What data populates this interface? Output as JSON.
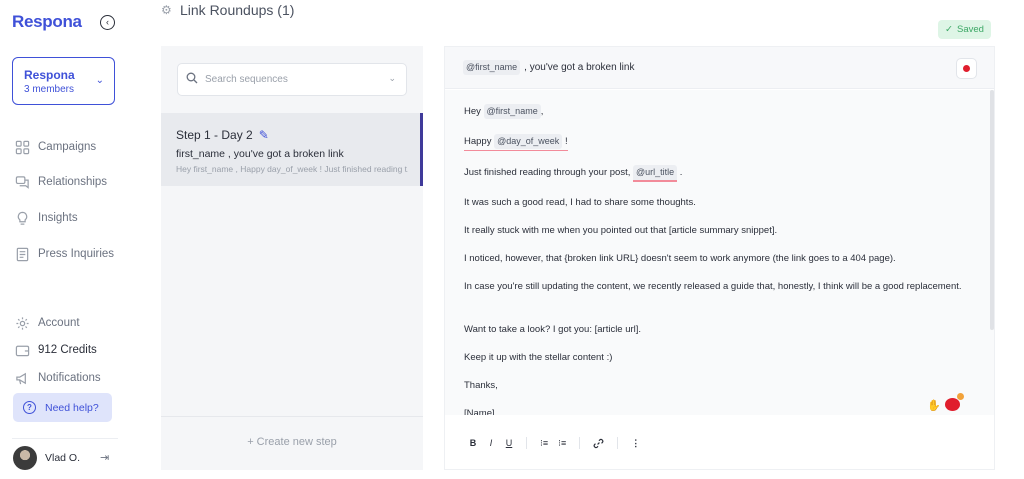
{
  "sidebar": {
    "logo": "Respona",
    "workspace": {
      "name": "Respona",
      "members": "3 members"
    },
    "nav": [
      {
        "label": "Campaigns",
        "icon": "grid-icon"
      },
      {
        "label": "Relationships",
        "icon": "chat-icon"
      },
      {
        "label": "Insights",
        "icon": "lightbulb-icon"
      },
      {
        "label": "Press Inquiries",
        "icon": "document-icon"
      }
    ],
    "bottom": [
      {
        "label": "Account",
        "icon": "gear-icon"
      },
      {
        "label": "912 Credits",
        "icon": "wallet-icon"
      },
      {
        "label": "Notifications",
        "icon": "megaphone-icon"
      }
    ],
    "help": "Need help?",
    "user": {
      "name": "Vlad O."
    }
  },
  "header": {
    "title": "Link Roundups (1)",
    "saved": "Saved"
  },
  "sequence": {
    "search_placeholder": "Search sequences",
    "step": {
      "title": "Step 1 - Day 2",
      "subject": "first_name , you've got a broken link",
      "preview": "Hey first_name , Happy day_of_week ! Just finished reading t..."
    },
    "create_step": "+ Create new step"
  },
  "editor": {
    "subject": {
      "variable": "@first_name",
      "text": ", you've got a broken link"
    },
    "body": {
      "hey": "Hey",
      "first_name": "@first_name",
      "comma": ",",
      "happy": "Happy",
      "day_of_week": "@day_of_week",
      "excl": "!",
      "just_finished": "Just finished reading through your post,",
      "url_title": "@url_title",
      "period": ".",
      "line4": "It was such a good read, I had to share some thoughts.",
      "line5": "It really stuck with me when you pointed out that [article summary snippet].",
      "line6": "I noticed, however, that {broken link URL} doesn't seem to work anymore (the link goes to a 404 page).",
      "line7": "In case you're still updating the content, we recently released a guide that, honestly, I think will be a good replacement.",
      "line8": "Want to take a look? I got you: [article url].",
      "line9": "Keep it up with the stellar content :)",
      "line10": "Thanks,",
      "line11": "[Name]"
    },
    "toolbar": {
      "bold": "B",
      "italic": "I",
      "underline": "U",
      "ordered_list": "⁝≡",
      "bullet_list": "⁝≡",
      "link": "🔗",
      "more": "⋮"
    }
  },
  "colors": {
    "accent": "#3f51d8",
    "saved_green": "#3da866",
    "record_red": "#e01e2d"
  }
}
